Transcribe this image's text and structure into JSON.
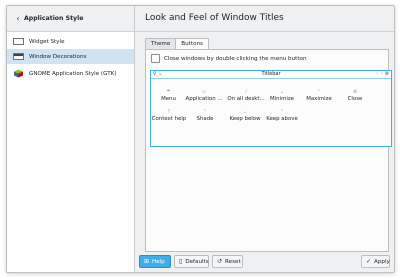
{
  "sidebar": {
    "title": "Application Style",
    "back_icon": "chevron-left-icon",
    "items": [
      {
        "label": "Widget Style",
        "icon": "widget-style-icon",
        "selected": false
      },
      {
        "label": "Window Decorations",
        "icon": "window-decorations-icon",
        "selected": true
      },
      {
        "label": "GNOME Application Style (GTK)",
        "icon": "gtk-icon",
        "selected": false
      }
    ]
  },
  "main": {
    "title": "Look and Feel of Window Titles",
    "tabs": [
      {
        "label": "Theme",
        "active": false
      },
      {
        "label": "Buttons",
        "active": true
      }
    ],
    "close_on_double_click": {
      "label": "Close windows by double clicking the menu button",
      "checked": false
    },
    "preview": {
      "titlebar_label": "Titlebar",
      "titlebar_left": "⚲ ⌄",
      "titlebar_right": "◦ ◦ ⊗",
      "available_buttons": [
        {
          "label": "Menu",
          "icon": "menu-icon",
          "glyph": "☂"
        },
        {
          "label": "Application ...",
          "icon": "application-menu-icon",
          "glyph": "▫"
        },
        {
          "label": "On all deskt...",
          "icon": "on-all-desktops-icon",
          "glyph": "∕"
        },
        {
          "label": "Minimize",
          "icon": "minimize-icon",
          "glyph": "⌄"
        },
        {
          "label": "Maximize",
          "icon": "maximize-icon",
          "glyph": "⌃"
        },
        {
          "label": "Close",
          "icon": "close-icon",
          "glyph": "⊗"
        },
        {
          "label": "Context help",
          "icon": "context-help-icon",
          "glyph": "?"
        },
        {
          "label": "Shade",
          "icon": "shade-icon",
          "glyph": "⌃"
        },
        {
          "label": "Keep below",
          "icon": "keep-below-icon",
          "glyph": "⌄"
        },
        {
          "label": "Keep above",
          "icon": "keep-above-icon",
          "glyph": "⌃"
        }
      ]
    }
  },
  "footer": {
    "help": {
      "label": "Help",
      "icon": "help-icon"
    },
    "defaults": {
      "label": "Defaults",
      "icon": "defaults-icon"
    },
    "reset": {
      "label": "Reset",
      "icon": "reset-icon"
    },
    "apply": {
      "label": "Apply",
      "icon": "apply-icon"
    }
  },
  "colors": {
    "accent": "#3daee9",
    "selection": "#cfe3f5",
    "window_bg": "#eff0f1"
  }
}
